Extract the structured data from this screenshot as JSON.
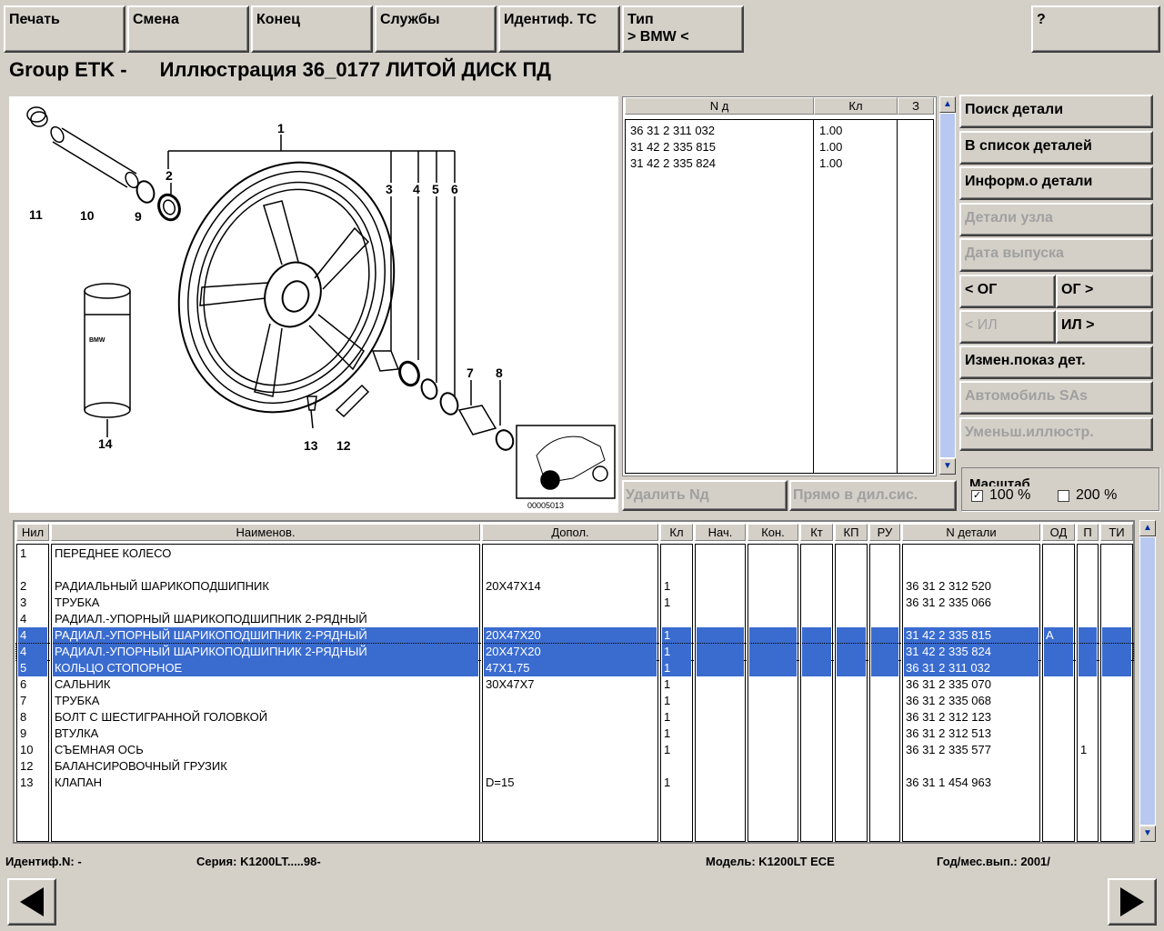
{
  "toolbar": {
    "print": "Печать",
    "change": "Смена",
    "end": "Конец",
    "services": "Службы",
    "ident_vehicle": "Идентиф. ТС",
    "type_label": "Тип",
    "type_value": "> BMW <",
    "help": "?"
  },
  "title": {
    "prefix": "Group ETK -",
    "text": "Иллюстрация  36_0177 ЛИТОЙ ДИСК ПД"
  },
  "illustration": {
    "callouts": [
      "1",
      "2",
      "3",
      "4",
      "5",
      "6",
      "7",
      "8",
      "9",
      "10",
      "11",
      "12",
      "13",
      "14"
    ],
    "label_bmw": "BMW",
    "code": "00005013"
  },
  "parts_list": {
    "headers": [
      "N д",
      "Кл",
      "З"
    ],
    "rows": [
      [
        "36 31 2 311 032",
        "1.00",
        ""
      ],
      [
        "31 42 2 335 815",
        "1.00",
        ""
      ],
      [
        "31 42 2 335 824",
        "1.00",
        ""
      ]
    ]
  },
  "list_buttons": {
    "delete": "Удалить Nд",
    "direct": "Прямо в дил.сис."
  },
  "side_buttons": {
    "search": "Поиск детали",
    "to_list": "В список деталей",
    "info": "Информ.о детали",
    "assembly": "Детали узла",
    "date": "Дата выпуска",
    "og_prev": "< ОГ",
    "og_next": "ОГ >",
    "il_prev": "< ИЛ",
    "il_next": "ИЛ >",
    "change_show": "Измен.показ дет.",
    "car_sas": "Автомобиль SAs",
    "shrink": "Уменьш.иллюстр."
  },
  "scale": {
    "label": "Масштаб",
    "opt100": "100 %",
    "opt200": "200 %",
    "checked100": "✓"
  },
  "main_table": {
    "headers": [
      "Нил",
      "Наименов.",
      "Допол.",
      "Кл",
      "Нач.",
      "Кон.",
      "Кт",
      "КП",
      "РУ",
      "N детали",
      "ОД",
      "П",
      "ТИ"
    ],
    "rows": [
      {
        "c": [
          "1",
          "ПЕРЕДНЕЕ КОЛЕСО",
          "",
          "",
          "",
          "",
          "",
          "",
          "",
          "",
          "",
          "",
          ""
        ],
        "sel": false
      },
      {
        "c": [
          "",
          "",
          "",
          "",
          "",
          "",
          "",
          "",
          "",
          "",
          "",
          "",
          ""
        ],
        "sel": false
      },
      {
        "c": [
          "2",
          "РАДИАЛЬНЫЙ ШАРИКОПОДШИПНИК",
          "20X47X14",
          "1",
          "",
          "",
          "",
          "",
          "",
          "36 31 2 312 520",
          "",
          "",
          ""
        ],
        "sel": false
      },
      {
        "c": [
          "3",
          "ТРУБКА",
          "",
          "1",
          "",
          "",
          "",
          "",
          "",
          "36 31 2 335 066",
          "",
          "",
          ""
        ],
        "sel": false
      },
      {
        "c": [
          "4",
          "РАДИАЛ.-УПОРНЫЙ ШАРИКОПОДШИПНИК 2-РЯДНЫЙ",
          "",
          "",
          "",
          "",
          "",
          "",
          "",
          "",
          "",
          "",
          ""
        ],
        "sel": false
      },
      {
        "c": [
          "4",
          "РАДИАЛ.-УПОРНЫЙ ШАРИКОПОДШИПНИК 2-РЯДНЫЙ",
          "20X47X20",
          "1",
          "",
          "",
          "",
          "",
          "",
          "31 42 2 335 815",
          "A",
          "",
          ""
        ],
        "sel": true
      },
      {
        "c": [
          "4",
          "РАДИАЛ.-УПОРНЫЙ ШАРИКОПОДШИПНИК 2-РЯДНЫЙ",
          "20X47X20",
          "1",
          "",
          "",
          "",
          "",
          "",
          "31 42 2 335 824",
          "",
          "",
          ""
        ],
        "sel": true,
        "focus": true
      },
      {
        "c": [
          "5",
          "КОЛЬЦО СТОПОРНОЕ",
          "47X1,75",
          "1",
          "",
          "",
          "",
          "",
          "",
          "36 31 2 311 032",
          "",
          "",
          ""
        ],
        "sel": true
      },
      {
        "c": [
          "6",
          "САЛЬНИК",
          "30X47X7",
          "1",
          "",
          "",
          "",
          "",
          "",
          "36 31 2 335 070",
          "",
          "",
          ""
        ],
        "sel": false
      },
      {
        "c": [
          "7",
          "ТРУБКА",
          "",
          "1",
          "",
          "",
          "",
          "",
          "",
          "36 31 2 335 068",
          "",
          "",
          ""
        ],
        "sel": false
      },
      {
        "c": [
          "8",
          "БОЛТ С ШЕСТИГРАННОЙ ГОЛОВКОЙ",
          "",
          "1",
          "",
          "",
          "",
          "",
          "",
          "36 31 2 312 123",
          "",
          "",
          ""
        ],
        "sel": false
      },
      {
        "c": [
          "9",
          "ВТУЛКА",
          "",
          "1",
          "",
          "",
          "",
          "",
          "",
          "36 31 2 312 513",
          "",
          "",
          ""
        ],
        "sel": false
      },
      {
        "c": [
          "10",
          "СЪЕМНАЯ ОСЬ",
          "",
          "1",
          "",
          "",
          "",
          "",
          "",
          "36 31 2 335 577",
          "",
          "1",
          ""
        ],
        "sel": false
      },
      {
        "c": [
          "12",
          "БАЛАНСИРОВОЧНЫЙ ГРУЗИК",
          "",
          "",
          "",
          "",
          "",
          "",
          "",
          "",
          "",
          "",
          ""
        ],
        "sel": false
      },
      {
        "c": [
          "13",
          "КЛАПАН",
          "D=15",
          "1",
          "",
          "",
          "",
          "",
          "",
          "36 31 1 454 963",
          "",
          "",
          ""
        ],
        "sel": false
      }
    ]
  },
  "status": {
    "ident": "Идентиф.N: -",
    "series": "Серия: K1200LT.....98-",
    "model": "Модель: K1200LT  ECE",
    "date": "Год/мес.вып.: 2001/"
  },
  "colors": {
    "selection": "#3a6cd0",
    "background": "#d4d0c8"
  }
}
